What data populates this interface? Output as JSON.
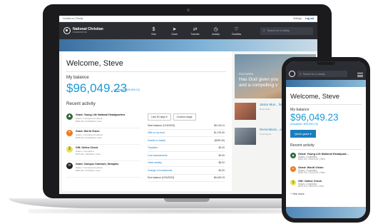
{
  "desktop": {
    "topbar": {
      "left": "Contact us  |  Family",
      "settings": "Settings",
      "login": "Log out"
    },
    "brand": {
      "name": "National Christian",
      "sub": "FOUNDATION"
    },
    "nav": [
      {
        "label": "Give",
        "icon": "$"
      },
      {
        "label": "Grant",
        "icon": "➤"
      },
      {
        "label": "Transfer",
        "icon": "⇄"
      },
      {
        "label": "Activity",
        "icon": "◷"
      },
      {
        "label": "Charities",
        "icon": "♡"
      }
    ],
    "search_placeholder": "Search for a charity",
    "welcome": "Welcome, Steve",
    "balance_label": "My balance",
    "balance": "$96,049.23",
    "available": "(Available: $95,559.23)",
    "recent_label": "Recent activity",
    "activities": [
      {
        "title": "Grant: Young Life National Headquarters",
        "status": "Status: Completed (mailed)",
        "meta": "$300.00 | 2/15/2023 | View",
        "color": "#2f6b3a",
        "icon": "▲"
      },
      {
        "title": "Grant: World Vision",
        "status": "Status: Completed (mailed)",
        "meta": "$155.00 | 2/12/2023 | View",
        "color": "#f07b22",
        "icon": "+"
      },
      {
        "title": "Gift: Online Check",
        "status": "Status: Completed",
        "meta": "$575.00 | 2/8/2023 | View",
        "color": "#e8e25a",
        "icon": "$"
      },
      {
        "title": "Grant: Campus Outreach, Memphis",
        "status": "Status: Completed (mailed)",
        "meta": "$500.00 | 2/1/2023 | View",
        "color": "#222222",
        "icon": "∞"
      }
    ],
    "filters": {
      "range": "Last 30 days",
      "custom": "Custom range"
    },
    "ledger": [
      {
        "label": "Start balance (1/15/2023)",
        "value": "$5,100.11",
        "link": false
      },
      {
        "label": "Gifts to my fund",
        "value": "$1,075.00",
        "link": true
      },
      {
        "label": "Grants to charity",
        "value": "($290.00)",
        "link": true
      },
      {
        "label": "Transfers",
        "value": "$0.00",
        "link": true
      },
      {
        "label": "Cost assessments",
        "value": "$0.00",
        "link": true
      },
      {
        "label": "Other activity",
        "value": "$6.02",
        "link": true
      },
      {
        "label": "Change in investments",
        "value": "$0.00",
        "link": true
      },
      {
        "label": "End balance (2/15/2023)",
        "value": "$6,049.23",
        "link": false
      }
    ],
    "featured": {
      "label": "FEATURED",
      "text": "Has God given you and a compelling v"
    },
    "articles": [
      {
        "title": "Janice Mun... heritage of g...",
        "by": "Bruce Allen"
      },
      {
        "title": "Remembera... original giving...",
        "by": "Todd Harper"
      }
    ]
  },
  "phone": {
    "search_placeholder": "Search for a charity",
    "welcome": "Welcome, Steve",
    "balance_label": "My balance",
    "balance": "$96,049.23",
    "available": "(Available: $95,559.23)",
    "quick_grant": "Quick grant",
    "recent_label": "Recent activity",
    "activities": [
      {
        "title": "Grant: Young Life National Headquart...",
        "status": "Status: Completed",
        "meta": "$300.00 | 2/15/2023 | View",
        "color": "#2f6b3a",
        "icon": "▲"
      },
      {
        "title": "Grant: World Vision",
        "status": "Status: Completed",
        "meta": "$155.00 | 2/12/2023 | View",
        "color": "#f07b22",
        "icon": "+"
      },
      {
        "title": "Gift: Online Check",
        "status": "Status: Completed",
        "meta": "$575.00 | 2/8/2023 | View",
        "color": "#e8e25a",
        "icon": "$"
      }
    ],
    "see_more": "+ See more"
  }
}
